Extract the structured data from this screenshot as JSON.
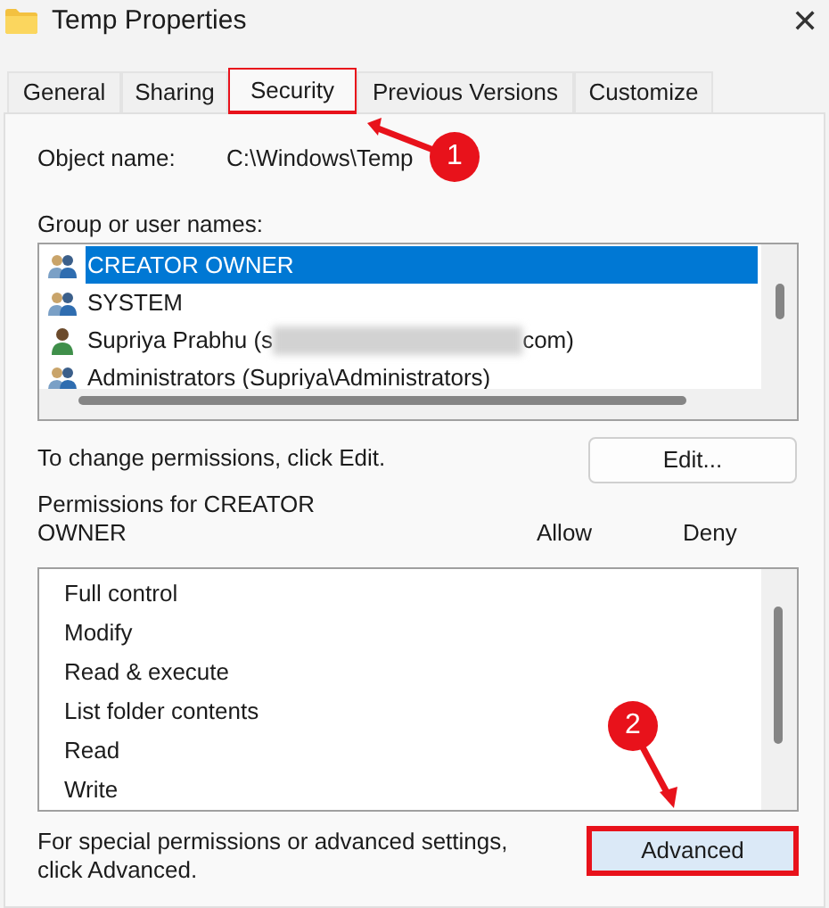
{
  "window": {
    "title": "Temp Properties",
    "close": "✕"
  },
  "tabs": [
    {
      "label": "General",
      "selected": false,
      "highlighted": false
    },
    {
      "label": "Sharing",
      "selected": false,
      "highlighted": false
    },
    {
      "label": "Security",
      "selected": true,
      "highlighted": true
    },
    {
      "label": "Previous Versions",
      "selected": false,
      "highlighted": false
    },
    {
      "label": "Customize",
      "selected": false,
      "highlighted": false
    }
  ],
  "object_name": {
    "label": "Object name:",
    "value": "C:\\Windows\\Temp"
  },
  "users": {
    "label": "Group or user names:",
    "items": [
      {
        "kind": "group",
        "label": "CREATOR OWNER",
        "selected": true
      },
      {
        "kind": "group",
        "label": "SYSTEM",
        "selected": false
      },
      {
        "kind": "user",
        "label": "Supriya Prabhu (s",
        "redacted": true,
        "label_end": "com)",
        "selected": false
      },
      {
        "kind": "group",
        "label": "Administrators (Supriya\\Administrators)",
        "selected": false
      }
    ]
  },
  "edit": {
    "hint": "To change permissions, click Edit.",
    "button": "Edit..."
  },
  "permissions": {
    "label": "Permissions for CREATOR OWNER",
    "columns": [
      "Allow",
      "Deny"
    ],
    "rows": [
      "Full control",
      "Modify",
      "Read & execute",
      "List folder contents",
      "Read",
      "Write"
    ]
  },
  "advanced": {
    "hint": "For special permissions or advanced settings, click Advanced.",
    "button": "Advanced",
    "highlighted": true
  },
  "callouts": [
    {
      "number": "1"
    },
    {
      "number": "2"
    }
  ]
}
